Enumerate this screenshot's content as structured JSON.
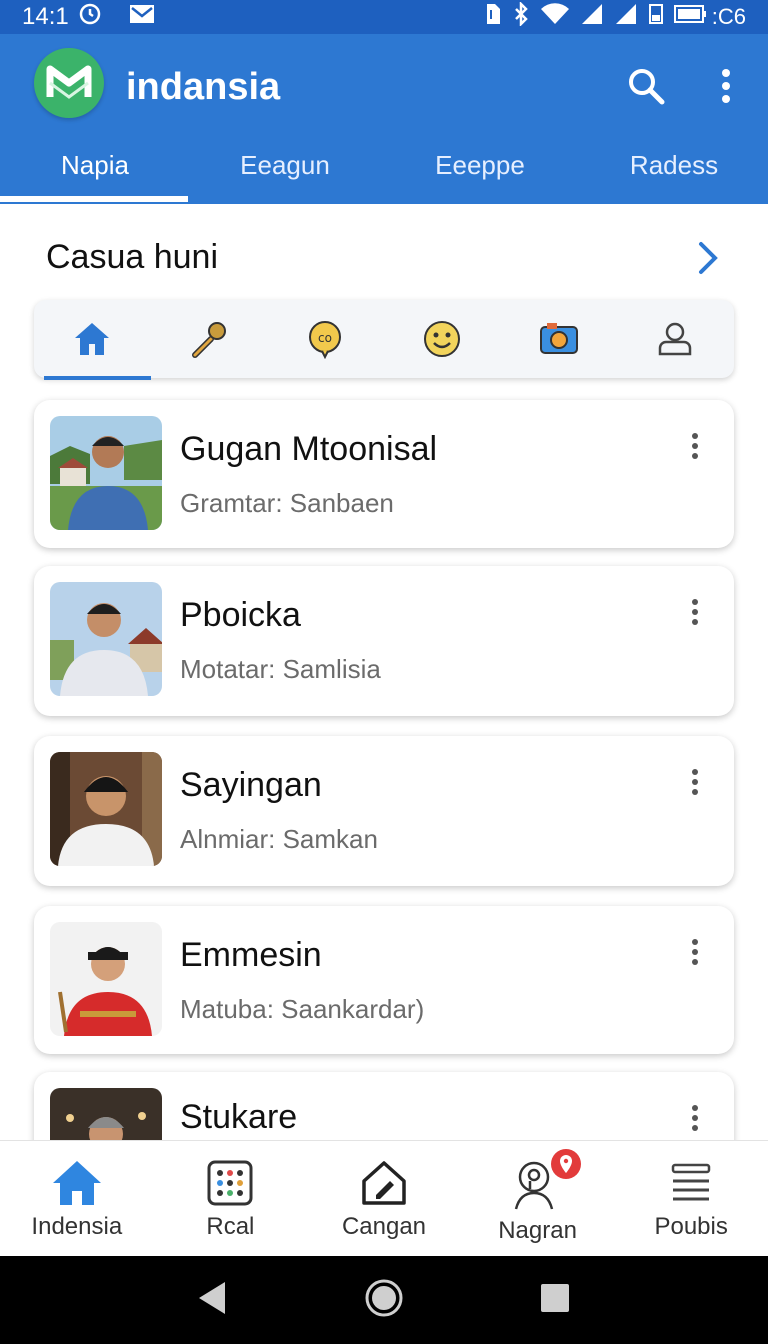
{
  "status_bar": {
    "time": "14:1",
    "right_text": ":C6"
  },
  "app": {
    "title": "indansia",
    "brand_color": "#2d78d2",
    "logo_color": "#3bb36a"
  },
  "tabs": [
    {
      "label": "Napia",
      "active": true
    },
    {
      "label": "Eeagun",
      "active": false
    },
    {
      "label": "Eeeppe",
      "active": false
    },
    {
      "label": "Radess",
      "active": false
    }
  ],
  "section": {
    "title": "Casua huni"
  },
  "categories": [
    {
      "icon": "home-icon",
      "active": true
    },
    {
      "icon": "microphone-icon",
      "active": false
    },
    {
      "icon": "chat-bubble-icon",
      "active": false
    },
    {
      "icon": "smiley-icon",
      "active": false
    },
    {
      "icon": "camera-icon",
      "active": false
    },
    {
      "icon": "person-icon",
      "active": false
    }
  ],
  "contacts": [
    {
      "name": "Gugan Mtoonisal",
      "subtitle": "Gramtar: Sanbaen"
    },
    {
      "name": "Pboicka",
      "subtitle": "Motatar: Samlisia"
    },
    {
      "name": "Sayingan",
      "subtitle": "Alnmiar: Samkan"
    },
    {
      "name": "Emmesin",
      "subtitle": "Matuba: Saankardar)"
    },
    {
      "name": "Stukare",
      "subtitle": ""
    }
  ],
  "bottom_nav": [
    {
      "label": "Indensia",
      "icon": "home-icon",
      "active": true
    },
    {
      "label": "Rcal",
      "icon": "grid-icon",
      "active": false
    },
    {
      "label": "Cangan",
      "icon": "edit-house-icon",
      "active": false
    },
    {
      "label": "Nagran",
      "icon": "location-person-icon",
      "active": false
    },
    {
      "label": "Poubis",
      "icon": "menu-stack-icon",
      "active": false
    }
  ]
}
